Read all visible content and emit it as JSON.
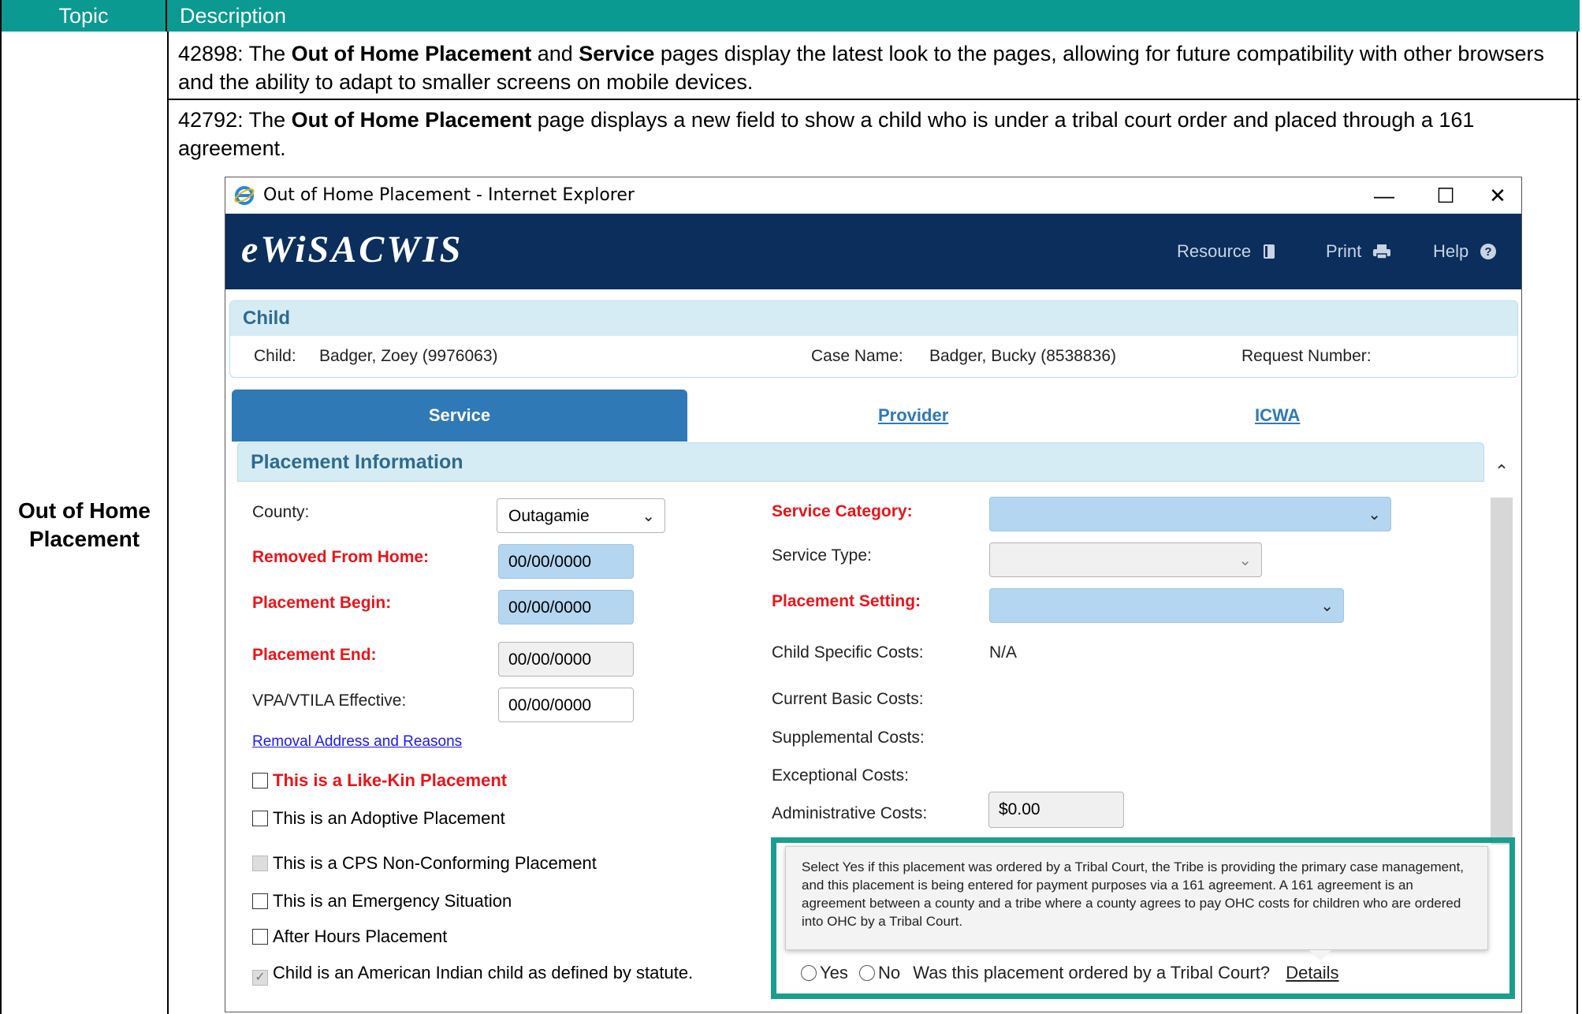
{
  "table": {
    "header_topic": "Topic",
    "header_description": "Description",
    "topic": "Out of Home Placement",
    "row1": {
      "id": "42898:",
      "t1": " The ",
      "b1": "Out of Home Placement",
      "t2": " and ",
      "b2": "Service",
      "t3": " pages display the latest look to the pages, allowing for future compatibility with other browsers and the ability to adapt to smaller screens on mobile devices."
    },
    "row2": {
      "id": "42792:",
      "t1": " The ",
      "b1": "Out of Home Placement",
      "t2": " page displays a new field to show a child who is under a tribal court order and placed through a 161 agreement."
    }
  },
  "window": {
    "title": "Out of Home Placement - Internet Explorer",
    "minimize": "—",
    "maximize": "☐",
    "close": "✕"
  },
  "app": {
    "logo": "eWiSACWIS",
    "nav": [
      {
        "label": "Resource",
        "icon": "book-icon"
      },
      {
        "label": "Print",
        "icon": "printer-icon"
      },
      {
        "label": "Help",
        "icon": "help-icon"
      }
    ]
  },
  "child_panel": {
    "title": "Child",
    "child_label": "Child:",
    "child_value": "Badger, Zoey (9976063)",
    "case_label": "Case Name:",
    "case_value": "Badger, Bucky (8538836)",
    "request_label": "Request Number:"
  },
  "tabs": {
    "service": "Service",
    "provider": "Provider",
    "icwa": "ICWA"
  },
  "placement": {
    "section_title": "Placement Information",
    "county_label": "County:",
    "county_value": "Outagamie",
    "removed_label": "Removed From Home:",
    "removed_value": "00/00/0000",
    "begin_label": "Placement Begin:",
    "begin_value": "00/00/0000",
    "end_label": "Placement End:",
    "end_value": "00/00/0000",
    "vpa_label": "VPA/VTILA Effective:",
    "vpa_value": "00/00/0000",
    "removal_link": "Removal Address and Reasons",
    "checkboxes": [
      {
        "label": "This is a Like-Kin Placement",
        "checked": false,
        "disabled": false,
        "required": true
      },
      {
        "label": "This is an Adoptive Placement",
        "checked": false,
        "disabled": false,
        "required": false
      },
      {
        "label": "This is a CPS Non-Conforming Placement",
        "checked": false,
        "disabled": true,
        "required": false
      },
      {
        "label": "This is an Emergency Situation",
        "checked": false,
        "disabled": false,
        "required": false
      },
      {
        "label": "After Hours Placement",
        "checked": false,
        "disabled": false,
        "required": false
      },
      {
        "label": "Child is an American Indian child as defined by statute.",
        "checked": true,
        "disabled": true,
        "required": false
      }
    ],
    "service_category_label": "Service Category:",
    "service_type_label": "Service Type:",
    "placement_setting_label": "Placement Setting:",
    "child_costs_label": "Child Specific Costs:",
    "child_costs_value": "N/A",
    "basic_costs_label": "Current Basic Costs:",
    "supplemental_label": "Supplemental Costs:",
    "exceptional_label": "Exceptional Costs:",
    "admin_label": "Administrative Costs:",
    "admin_value": "$0.00"
  },
  "tribal": {
    "tooltip": "Select Yes if this placement was ordered by a Tribal Court, the Tribe is providing the primary case management, and this placement is being entered for payment purposes via a 161 agreement. A 161 agreement is an agreement between a county and a tribe where a county agrees to pay OHC costs for children who are ordered into OHC by a Tribal Court.",
    "yes": "Yes",
    "no": "No",
    "question": "Was this placement ordered by a Tribal Court?",
    "details": "Details"
  },
  "colors": {
    "header_bg": "#0a9a92",
    "app_bar": "#0b2e5c",
    "tab_active": "#2f79b7",
    "required_red": "#e8151a",
    "callout_border": "#1a9e8e",
    "field_blue": "#b4d6f0"
  }
}
